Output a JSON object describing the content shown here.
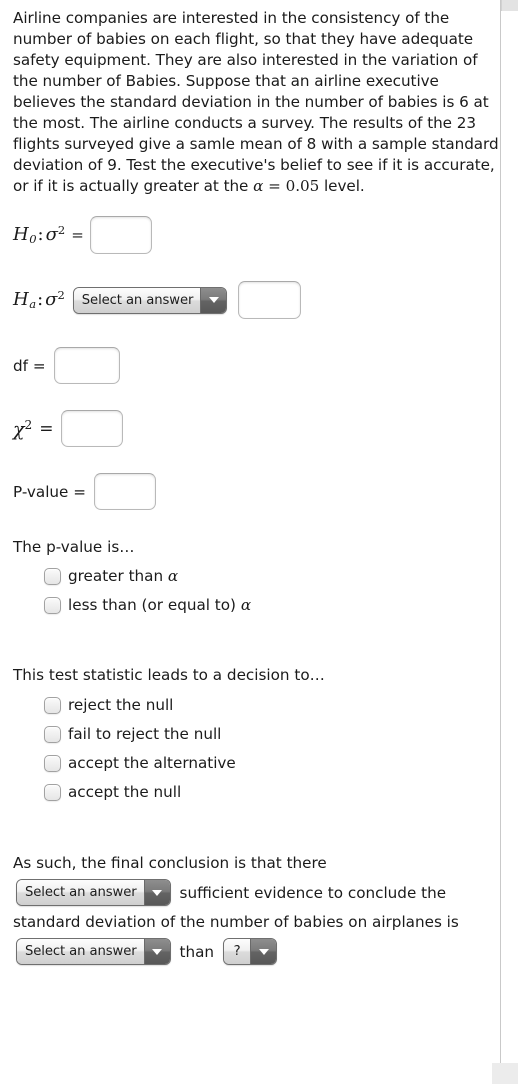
{
  "problem": {
    "text": "Airline companies are interested in the consistency of the number of babies on each flight, so that they have adequate safety equipment. They are also interested in the variation of the number of Babies. Suppose that an airline executive believes the standard deviation in the number of babies is 6 at the most. The airline conducts a survey. The results of the 23 flights surveyed give a samle mean of 8 with a sample standard deviation of 9. Test the executive's belief to see if it is accurate, or if it is actually greater at the ",
    "alpha_symbol": "α",
    "alpha_equals": " = ",
    "alpha_value": "0.05",
    "text_tail": " level."
  },
  "hypotheses": {
    "null": {
      "H": "H",
      "sub": "0",
      "colon": ":",
      "sigma": "σ",
      "sup": "2",
      "equals": "=",
      "value": ""
    },
    "alt": {
      "H": "H",
      "sub": "a",
      "colon": ":",
      "sigma": "σ",
      "sup": "2",
      "select_label": "Select an answer",
      "value": ""
    }
  },
  "fields": {
    "df_label": "df =",
    "df_value": "",
    "chi_symbol": "χ",
    "chi_sup": "2",
    "chi_equals": "=",
    "chi_value": "",
    "pvalue_label": "P-value =",
    "pvalue_value": ""
  },
  "pvalue_question": {
    "heading": "The p-value is…",
    "options": [
      {
        "label": "greater than ",
        "math": "α",
        "checked": false
      },
      {
        "label": "less than (or equal to) ",
        "math": "α",
        "checked": false
      }
    ]
  },
  "decision_question": {
    "heading": "This test statistic leads to a decision to…",
    "options": [
      {
        "label": "reject the null",
        "checked": false
      },
      {
        "label": "fail to reject the null",
        "checked": false
      },
      {
        "label": "accept the alternative",
        "checked": false
      },
      {
        "label": "accept the null",
        "checked": false
      }
    ]
  },
  "conclusion": {
    "line1": "As such, the final conclusion is that there",
    "select1_label": "Select an answer",
    "line2": "sufficient evidence to conclude the",
    "line3": "standard deviation of the number of babies on airplanes is",
    "select2_label": "Select an answer",
    "than_word": "than",
    "select3_label": "?"
  },
  "icons": {
    "dropdown_arrow": "chevron-down-icon"
  },
  "colors": {
    "page_background": "#ffffff",
    "text": "#1b1b1b",
    "input_border": "#b9b9b9",
    "select_border": "#6f6f6f",
    "select_arrow_bg": "#6d6d6d",
    "divider": "#c9c9c9"
  }
}
